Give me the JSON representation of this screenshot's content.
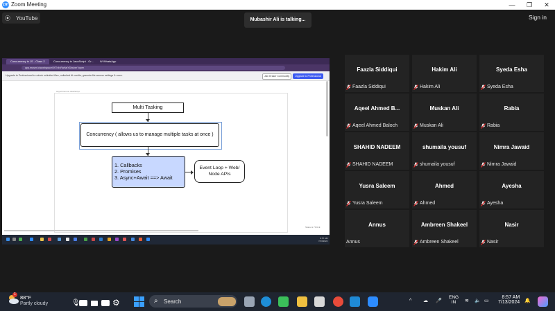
{
  "window": {
    "title": "Zoom Meeting",
    "app_logo": "zm"
  },
  "topbar": {
    "youtube_label": "YouTube",
    "talking": "Mubashir Ali is talking...",
    "signin": "Sign in"
  },
  "share": {
    "tabs": [
      "Concurrency in JS - Class 2",
      "Concurrency in JavaScript - Gr…",
      "W WhatsApp"
    ],
    "url": "app.eraser.io/workspace/fXTh4vRaHaiYDbubm?open",
    "banner": "Upgrade to Professional to unlock unlimited files, unlimited AI credits, granular file access settings & more.",
    "join_btn": "Join Eraser Community",
    "upgrade_btn": "Upgrade to Professional",
    "canvas_caption": "Asynchronous JavaScript",
    "diagram": {
      "multi_tasking": "Multi Tasking",
      "concurrency": "Concurrency ( allows us to manage multiple tasks at once )",
      "callbacks_lines": [
        "1.  Callbacks",
        "2.  Promises",
        "3.  Async+Await ==> Await"
      ],
      "event_loop_lines": [
        "Event Loop + Web/",
        "Node  APIs"
      ]
    },
    "zoom_control": "Share  ⊖ 71% ⊕",
    "clock_time": "8:57 AM",
    "clock_date": "7/13/2024"
  },
  "participants": [
    {
      "tile": "Faazla Siddiqui",
      "label": "Faazla Siddiqui",
      "muted": true
    },
    {
      "tile": "Hakim Ali",
      "label": "Hakim Ali",
      "muted": true
    },
    {
      "tile": "Syeda Esha",
      "label": "Syeda Esha",
      "muted": true
    },
    {
      "tile": "Aqeel Ahmed B...",
      "label": "Aqeel Ahmed Baloch",
      "muted": true
    },
    {
      "tile": "Muskan Ali",
      "label": "Muskan Ali",
      "muted": true
    },
    {
      "tile": "Rabia",
      "label": "Rabia",
      "muted": true
    },
    {
      "tile": "SHAHID NADEEM",
      "label": "SHAHID NADEEM",
      "muted": true
    },
    {
      "tile": "shumaila yousuf",
      "label": "shumaila yousuf",
      "muted": true
    },
    {
      "tile": "Nimra Jawaid",
      "label": "Nimra Jawaid",
      "muted": true
    },
    {
      "tile": "Yusra Saleem",
      "label": "Yusra Saleem",
      "muted": true
    },
    {
      "tile": "Ahmed",
      "label": "Ahmed",
      "muted": true
    },
    {
      "tile": "Ayesha",
      "label": "Ayesha",
      "muted": true
    },
    {
      "tile": "Annus",
      "label": "Annus",
      "muted": false
    },
    {
      "tile": "Ambreen Shakeel",
      "label": "Ambreen Shakeel",
      "muted": true
    },
    {
      "tile": "Nasir",
      "label": "Nasir",
      "muted": true
    }
  ],
  "taskbar": {
    "weather_temp": "88°F",
    "weather_cond": "Partly cloudy",
    "weather_badge": "1",
    "search": "Search",
    "lang_top": "ENG",
    "lang_bottom": "IN",
    "time": "8:57 AM",
    "date": "7/13/2024",
    "app_icons": [
      "file-explorer-icon",
      "edge-icon",
      "app-icon",
      "folder-icon",
      "store-icon",
      "chrome-icon",
      "vscode-icon",
      "zoom-icon"
    ]
  },
  "colors": {
    "zoom_blue": "#2d8cff",
    "muted_red": "#e02828",
    "diagram_blue": "#c8d8ff",
    "browser_purple": "#3c2a55"
  }
}
